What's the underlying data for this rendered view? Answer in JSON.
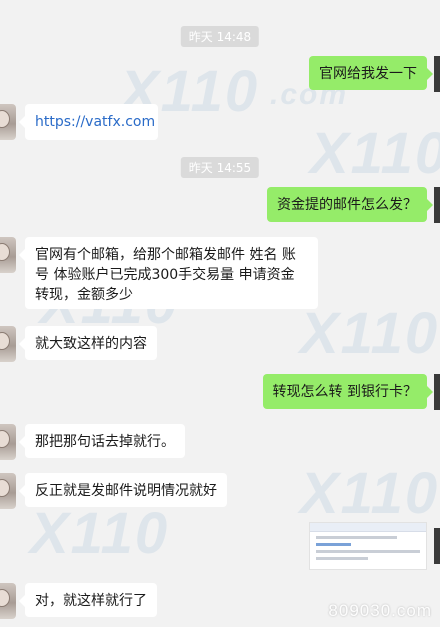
{
  "timestamps": [
    "昨天 14:48",
    "昨天 14:55"
  ],
  "messages": {
    "m1": "官网给我发一下",
    "m2": "https://vatfx.com",
    "m3": "资金提的邮件怎么发？",
    "m4": "官网有个邮箱，给那个邮箱发邮件   姓名  账号  体验账户已完成300手交易量   申请资金转现，金额多少",
    "m5": "就大致这样的内容",
    "m6": "转现怎么转  到银行卡？",
    "m7": "那把那句话去掉就行。",
    "m8": "反正就是发邮件说明情况就好",
    "m10": "对，就这样就行了"
  },
  "watermark": {
    "brand": "X110",
    "suffix": ".com"
  },
  "footer_mark": "809030.com",
  "colors": {
    "sent_bubble": "#95ec69",
    "received_bubble": "#ffffff",
    "background": "#f2f2f2",
    "link": "#2a6bc8"
  }
}
